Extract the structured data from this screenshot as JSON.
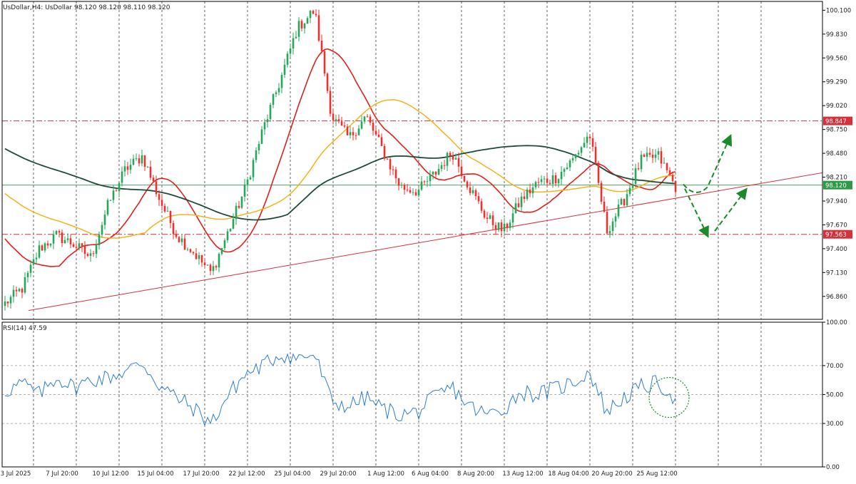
{
  "header": {
    "title": "UsDollar,H4:  UsDollar  98.120 98.120 98.110 98.120"
  },
  "rsi_label": "RSI(14) 47.59",
  "colors": {
    "bull": "#26a65b",
    "bear": "#e8322f",
    "ma_fast": "#e0201c",
    "ma_mid": "#f5b21d",
    "ma_slow": "#1e4a3a",
    "rsi_line": "#2f7fd3",
    "annotation": "#1a8a2a",
    "level_line": "#d6303a",
    "current_line": "#2e9a47"
  },
  "chart_data": [
    {
      "type": "candlestick",
      "title": "UsDollar,H4",
      "ylim": [
        96.6,
        100.2
      ],
      "yticks": [
        "100.100",
        "99.830",
        "99.560",
        "99.290",
        "99.020",
        "98.750",
        "98.480",
        "98.210",
        "97.940",
        "97.670",
        "97.400",
        "97.130",
        "96.860"
      ],
      "xticks": [
        "3 Jul 2025",
        "7 Jul 20:00",
        "10 Jul 12:00",
        "15 Jul 04:00",
        "17 Jul 20:00",
        "22 Jul 12:00",
        "25 Jul 04:00",
        "29 Jul 20:00",
        "1 Aug 12:00",
        "6 Aug 04:00",
        "8 Aug 20:00",
        "13 Aug 12:00",
        "18 Aug 04:00",
        "20 Aug 20:00",
        "25 Aug 12:00"
      ],
      "close_anchors": [
        96.78,
        96.95,
        97.4,
        97.55,
        97.45,
        97.3,
        97.9,
        98.3,
        98.45,
        97.95,
        97.55,
        97.35,
        97.12,
        97.6,
        98.1,
        98.75,
        99.3,
        99.9,
        100.1,
        98.9,
        98.65,
        98.9,
        98.5,
        98.1,
        98.05,
        98.25,
        98.5,
        98.1,
        97.75,
        97.6,
        97.95,
        98.15,
        98.2,
        98.4,
        98.7,
        97.6,
        97.95,
        98.4,
        98.45,
        98.1
      ],
      "levels": [
        {
          "label": "98.847",
          "value": 98.847,
          "style": "dash-dot"
        },
        {
          "label": "97.563",
          "value": 97.563,
          "style": "dash-dot"
        }
      ],
      "current_price": {
        "label": "98.120",
        "value": 98.12
      },
      "trendline": {
        "from": {
          "x": "3 Jul 2025",
          "y": 96.7
        },
        "to": {
          "x": "right edge",
          "y": 98.26
        }
      },
      "moving_averages": [
        "red (fast)",
        "orange (medium)",
        "dark green (slow)"
      ],
      "annotations": [
        "green dashed arrow up from 98.12 toward 98.60",
        "green dashed arrow down to 97.60 then up toward 98.10"
      ]
    },
    {
      "type": "line",
      "title": "RSI(14) 47.59",
      "ylim": [
        0,
        100
      ],
      "yticks": [
        "100.00",
        "70.00",
        "50.00",
        "30.00",
        "0.00"
      ],
      "levels": [
        70,
        50,
        30
      ],
      "value_anchors": [
        52,
        58,
        50,
        62,
        55,
        60,
        62,
        66,
        72,
        56,
        48,
        40,
        30,
        50,
        64,
        70,
        78,
        75,
        78,
        45,
        42,
        48,
        40,
        36,
        38,
        48,
        55,
        42,
        36,
        40,
        52,
        50,
        54,
        58,
        66,
        38,
        48,
        55,
        58,
        47.59
      ],
      "annotation": "green dotted circle around latest readings"
    }
  ]
}
